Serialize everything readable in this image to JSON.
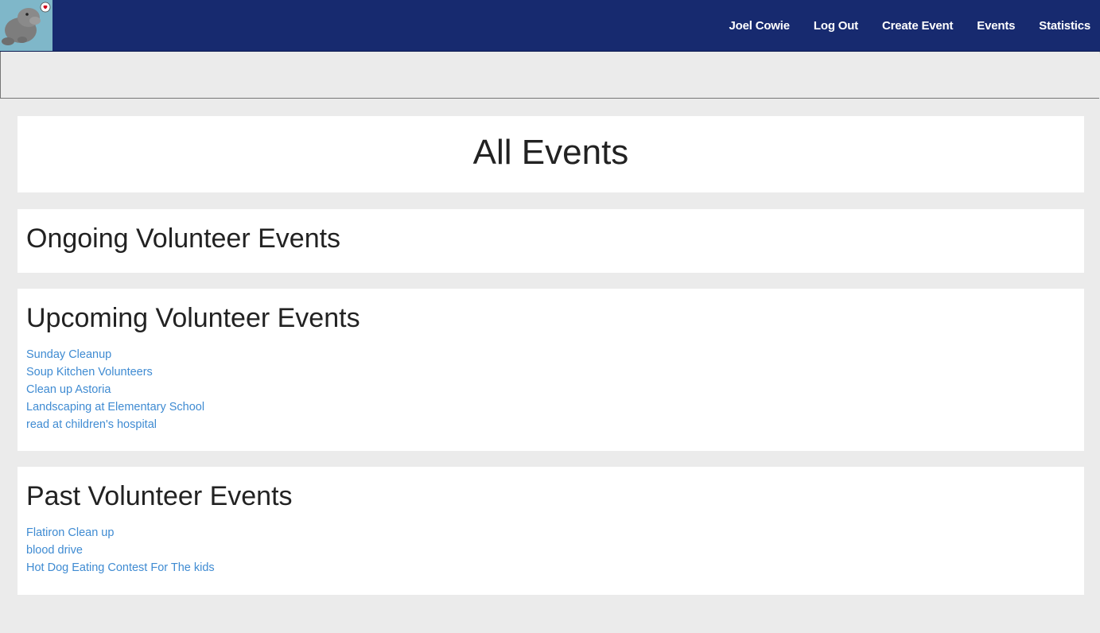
{
  "navbar": {
    "logo_icon": "manatee-heart-logo-icon",
    "bg_color": "#172a6f",
    "links": [
      {
        "label": "Joel Cowie"
      },
      {
        "label": "Log Out"
      },
      {
        "label": "Create Event"
      },
      {
        "label": "Events"
      },
      {
        "label": "Statistics"
      }
    ]
  },
  "main": {
    "title": "All Events",
    "ongoing": {
      "heading": "Ongoing Volunteer Events",
      "events": []
    },
    "upcoming": {
      "heading": "Upcoming Volunteer Events",
      "events": [
        "Sunday Cleanup",
        "Soup Kitchen Volunteers",
        "Clean up Astoria",
        "Landscaping at Elementary School",
        "read at children's hospital"
      ]
    },
    "past": {
      "heading": "Past Volunteer Events",
      "events": [
        "Flatiron Clean up",
        "blood drive",
        "Hot Dog Eating Contest For The kids"
      ]
    }
  },
  "colors": {
    "link": "#3f8bd2",
    "page_bg": "#ebebeb"
  }
}
